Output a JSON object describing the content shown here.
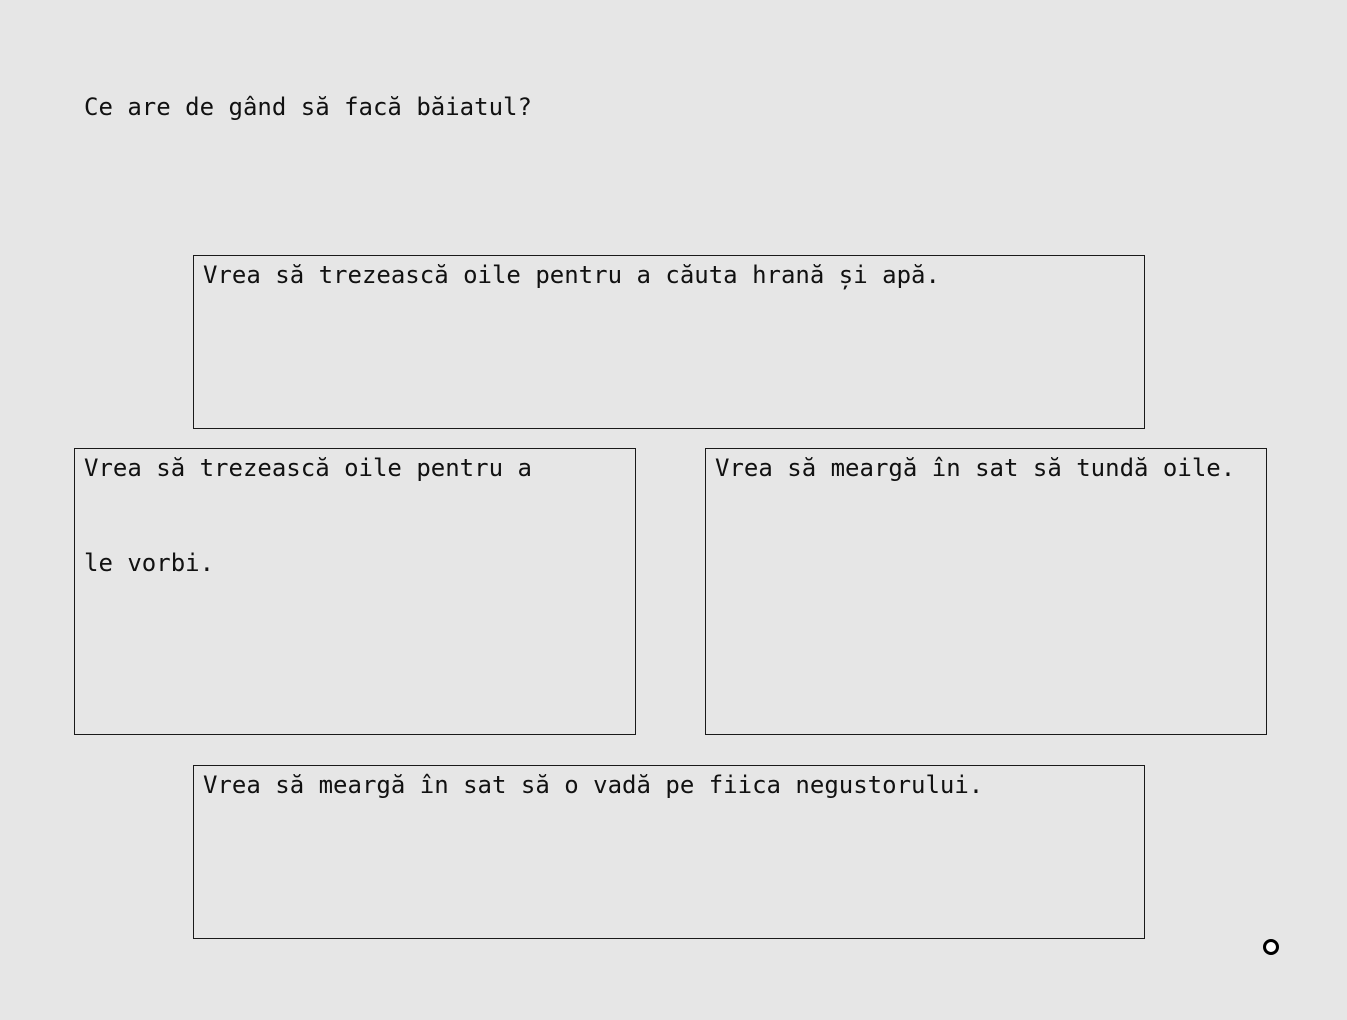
{
  "quiz": {
    "question": "Ce are de gând să facă băiatul?",
    "answers": [
      {
        "text": "Vrea să trezească oile pentru a căuta hrană și apă."
      },
      {
        "text": "Vrea să trezească oile pentru a le vorbi."
      },
      {
        "text": "Vrea să meargă în sat să tundă oile."
      },
      {
        "text": "Vrea să meargă în sat să o vadă pe fiica negustorului."
      }
    ]
  },
  "cursor": {
    "icon": "ring-cursor-icon"
  }
}
